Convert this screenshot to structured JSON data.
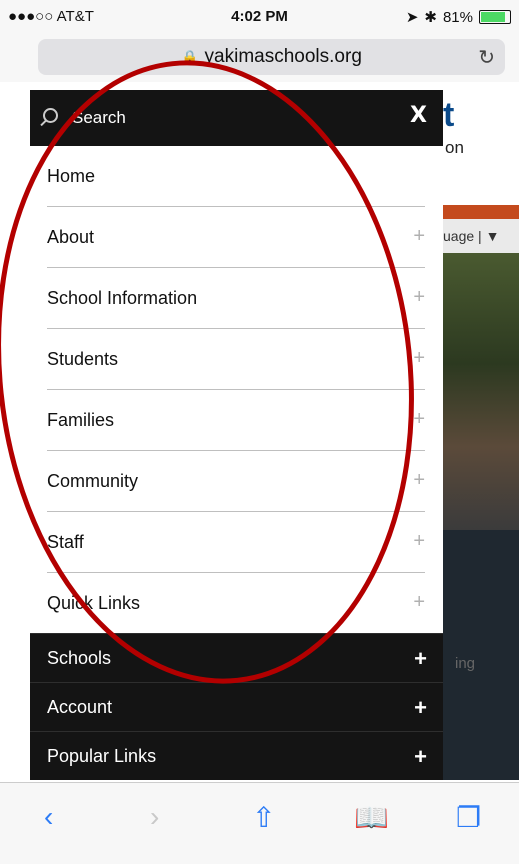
{
  "status": {
    "carrier": "●●●○○ AT&T",
    "time": "4:02 PM",
    "battery": "81%"
  },
  "browser": {
    "url": "yakimaschools.org"
  },
  "background": {
    "title_fragment": "t",
    "subtitle_fragment": "on",
    "language_fragment": "uage",
    "dark_fragment": "ing"
  },
  "menu": {
    "search_label": "Search",
    "close_label": "X",
    "items": [
      {
        "label": "Home"
      },
      {
        "label": "About"
      },
      {
        "label": "School Information"
      },
      {
        "label": "Students"
      },
      {
        "label": "Families"
      },
      {
        "label": "Community"
      },
      {
        "label": "Staff"
      },
      {
        "label": "Quick Links"
      }
    ],
    "dark_items": [
      {
        "label": "Schools"
      },
      {
        "label": "Account"
      },
      {
        "label": "Popular Links"
      }
    ],
    "plus_symbol": "+"
  },
  "colors": {
    "annotation": "#b30000",
    "menu_dark": "#141414",
    "toolbar_icons": "#2d7cf6"
  }
}
